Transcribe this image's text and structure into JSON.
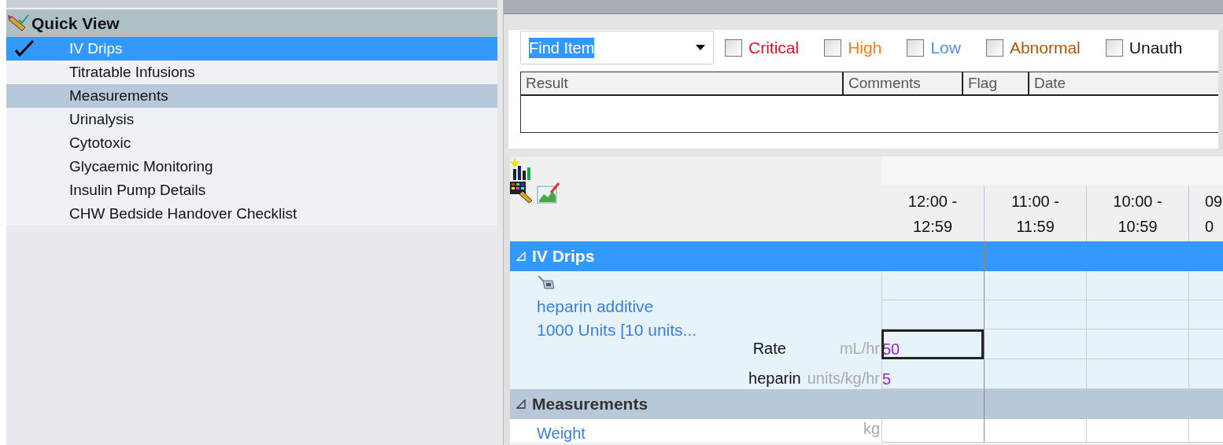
{
  "quick_view": {
    "title": "Quick View",
    "items": [
      {
        "label": "IV Drips",
        "selected": true,
        "checked": true,
        "highlighted": false
      },
      {
        "label": "Titratable Infusions",
        "selected": false,
        "checked": false,
        "highlighted": false
      },
      {
        "label": "Measurements",
        "selected": false,
        "checked": false,
        "highlighted": true
      },
      {
        "label": "Urinalysis",
        "selected": false,
        "checked": false,
        "highlighted": false
      },
      {
        "label": "Cytotoxic",
        "selected": false,
        "checked": false,
        "highlighted": false
      },
      {
        "label": "Glycaemic Monitoring",
        "selected": false,
        "checked": false,
        "highlighted": false
      },
      {
        "label": "Insulin Pump Details",
        "selected": false,
        "checked": false,
        "highlighted": false
      },
      {
        "label": "CHW Bedside Handover Checklist",
        "selected": false,
        "checked": false,
        "highlighted": false
      }
    ]
  },
  "find_item": {
    "value": "Find Item"
  },
  "filters": [
    {
      "label": "Critical",
      "checked": false,
      "color": "#e3102a"
    },
    {
      "label": "High",
      "checked": false,
      "color": "#ff7b1c"
    },
    {
      "label": "Low",
      "checked": false,
      "color": "#4a8ee6"
    },
    {
      "label": "Abnormal",
      "checked": false,
      "color": "#b0570e"
    },
    {
      "label": "Unauth",
      "checked": false,
      "color": "#111111"
    }
  ],
  "results_table": {
    "columns": [
      "Result",
      "Comments",
      "Flag",
      "Date"
    ]
  },
  "flowsheet": {
    "time_columns": [
      {
        "line1": "12:00 -",
        "line2": "12:59"
      },
      {
        "line1": "11:00 -",
        "line2": "11:59"
      },
      {
        "line1": "10:00 -",
        "line2": "10:59"
      },
      {
        "line1": "09",
        "line2": "0"
      }
    ],
    "sections": [
      {
        "title": "IV Drips",
        "selected": true,
        "expanded": true,
        "kind": "drips",
        "orders": [
          {
            "name": "heparin additive",
            "detail": "1000 Units [10 units...",
            "parameters": [
              {
                "label": "Rate",
                "unit": "mL/hr",
                "value": "50",
                "selected": true
              },
              {
                "label": "heparin",
                "unit": "units/kg/hr",
                "value": "5",
                "selected": false
              }
            ]
          }
        ]
      },
      {
        "title": "Measurements",
        "selected": false,
        "expanded": true,
        "kind": "measures",
        "rows": [
          {
            "label": "Weight",
            "unit": "kg"
          }
        ]
      }
    ]
  }
}
